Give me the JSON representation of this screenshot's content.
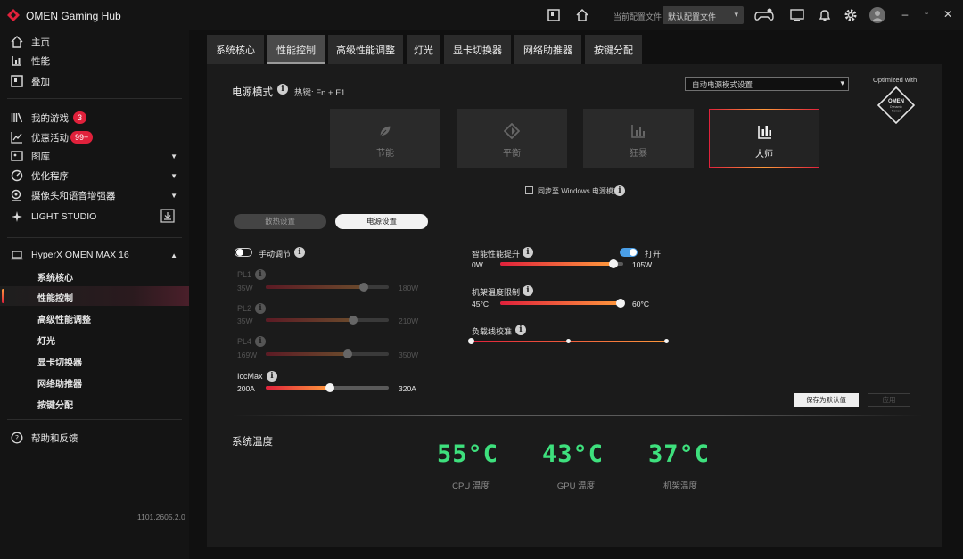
{
  "app": {
    "title": "OMEN Gaming Hub",
    "profile_label": "当前配置文件",
    "profile_value": "默认配置文件",
    "version": "1101.2605.2.0"
  },
  "sidebar": {
    "top_items": [
      {
        "label": "主页",
        "icon": "home-icon"
      },
      {
        "label": "性能",
        "icon": "performance-icon"
      },
      {
        "label": "叠加",
        "icon": "overlay-icon"
      }
    ],
    "library_items": [
      {
        "label": "我的游戏",
        "icon": "games-library-icon",
        "badge": "3"
      },
      {
        "label": "优惠活动",
        "icon": "deals-chart-icon",
        "badge": "99+"
      },
      {
        "label": "图库",
        "icon": "gallery-icon"
      },
      {
        "label": "优化程序",
        "icon": "optimizer-icon"
      },
      {
        "label": "摄像头和语音增强器",
        "icon": "camera-voice-icon"
      },
      {
        "label": "LIGHT STUDIO",
        "icon": "light-studio-icon"
      }
    ],
    "device": {
      "label": "HyperX OMEN MAX 16",
      "icon": "laptop-icon",
      "sub_items": [
        "系统核心",
        "性能控制",
        "高级性能调整",
        "灯光",
        "显卡切换器",
        "网络助推器",
        "按键分配"
      ],
      "active_index": 1
    },
    "help": {
      "label": "帮助和反馈",
      "icon": "help-icon"
    }
  },
  "tabs": [
    "系统核心",
    "性能控制",
    "高级性能调整",
    "灯光",
    "显卡切换器",
    "网络助推器",
    "按键分配"
  ],
  "active_tab": 1,
  "power": {
    "title": "电源模式",
    "hotkey": "热键: Fn + F1",
    "dropdown": "自动电源模式设置",
    "optimized_label": "Optimized with",
    "logo_text": [
      "OMEN",
      "Dynamic",
      "Power"
    ],
    "modes": [
      {
        "label": "节能",
        "icon": "leaf-icon"
      },
      {
        "label": "平衡",
        "icon": "balance-diamond-icon"
      },
      {
        "label": "狂暴",
        "icon": "performance-bars-icon"
      },
      {
        "label": "大师",
        "icon": "master-bars-icon"
      }
    ],
    "active_mode": 3,
    "sync_label": "同步至 Windows 电源模式"
  },
  "segmented": {
    "options": [
      "散热设置",
      "电源设置"
    ],
    "selected": 1
  },
  "manual": {
    "label": "手动调节",
    "enabled": false
  },
  "sliders_left": [
    {
      "label": "PL1",
      "min": "35W",
      "max": "180W",
      "fraction": 0.8,
      "enabled": false
    },
    {
      "label": "PL2",
      "min": "35W",
      "max": "210W",
      "fraction": 0.71,
      "enabled": false
    },
    {
      "label": "PL4",
      "min": "169W",
      "max": "350W",
      "fraction": 0.67,
      "enabled": false
    },
    {
      "label": "IccMax",
      "min": "200A",
      "max": "320A",
      "fraction": 0.52,
      "enabled": true
    }
  ],
  "smart_boost": {
    "label": "智能性能提升",
    "min": "0W",
    "max": "105W",
    "fraction": 0.92,
    "toggle_label": "打开",
    "enabled": true
  },
  "chassis_temp": {
    "label": "机架温度限制",
    "min": "45°C",
    "max": "60°C",
    "fraction": 1.0
  },
  "load_line": {
    "label": "负载线校准",
    "positions": [
      0,
      0.5,
      1
    ]
  },
  "buttons": {
    "save_default": "保存为默认值",
    "apply": "应用"
  },
  "system_temp": {
    "title": "系统温度",
    "items": [
      {
        "value": "55°C",
        "label": "CPU 温度"
      },
      {
        "value": "43°C",
        "label": "GPU 温度"
      },
      {
        "value": "37°C",
        "label": "机架温度"
      }
    ]
  },
  "colors": {
    "accent_red": "#e0213b",
    "accent_orange": "#ff9a3c",
    "temp_green": "#3ee07d",
    "toggle_blue": "#4a9fe8"
  }
}
